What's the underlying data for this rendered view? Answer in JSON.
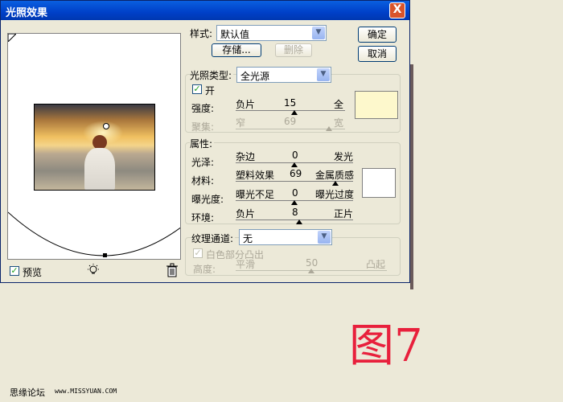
{
  "window": {
    "title": "光照效果",
    "close_label": "X"
  },
  "buttons": {
    "ok": "确定",
    "cancel": "取消",
    "save": "存储...",
    "delete": "删除"
  },
  "style_row": {
    "label": "样式:",
    "value": "默认值"
  },
  "light_type": {
    "label": "光照类型:",
    "value": "全光源",
    "on_label": "开",
    "on_checked": true,
    "intensity": {
      "label": "强度:",
      "min_label": "负片",
      "value": "15",
      "max_label": "全",
      "fraction": 0.54
    },
    "focus": {
      "label": "聚集:",
      "min_label": "窄",
      "value": "69",
      "max_label": "宽",
      "fraction": 0.85
    },
    "color": "#fdf8cc"
  },
  "properties": {
    "label": "属性:",
    "gloss": {
      "label": "光泽:",
      "min_label": "杂边",
      "value": "0",
      "max_label": "发光",
      "fraction": 0.5
    },
    "material": {
      "label": "材料:",
      "min_label": "塑料效果",
      "value": "69",
      "max_label": "金属质感",
      "fraction": 0.85
    },
    "exposure": {
      "label": "曝光度:",
      "min_label": "曝光不足",
      "value": "0",
      "max_label": "曝光过度",
      "fraction": 0.5
    },
    "ambience": {
      "label": "环境:",
      "min_label": "负片",
      "value": "8",
      "max_label": "正片",
      "fraction": 0.54
    },
    "color": "#ffffff"
  },
  "texture": {
    "label": "纹理通道:",
    "value": "无",
    "white_high_label": "白色部分凸出",
    "white_high_checked": true,
    "height": {
      "label": "高度:",
      "min_label": "平滑",
      "value": "50",
      "max_label": "凸起",
      "fraction": 0.5
    }
  },
  "preview": {
    "label": "预览",
    "checked": true
  },
  "figure_label": "图7",
  "footer": {
    "site_name": "思缘论坛",
    "url": "www.MISSYUAN.COM"
  }
}
